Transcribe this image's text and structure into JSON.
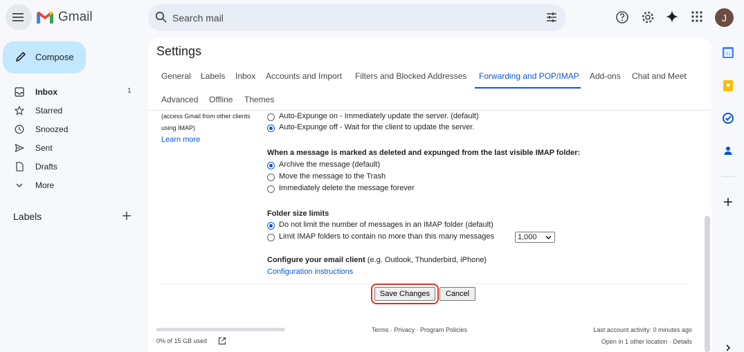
{
  "app": {
    "name": "Gmail",
    "search_placeholder": "Search mail",
    "avatar_initial": "J"
  },
  "sidebar": {
    "compose_label": "Compose",
    "items": [
      {
        "label": "Inbox",
        "count": "1",
        "icon": "inbox-icon"
      },
      {
        "label": "Starred",
        "count": "",
        "icon": "star-icon"
      },
      {
        "label": "Snoozed",
        "count": "",
        "icon": "clock-icon"
      },
      {
        "label": "Sent",
        "count": "",
        "icon": "send-icon"
      },
      {
        "label": "Drafts",
        "count": "",
        "icon": "draft-icon"
      },
      {
        "label": "More",
        "count": "",
        "icon": "chevron-down-icon"
      }
    ],
    "labels_header": "Labels"
  },
  "settings": {
    "title": "Settings",
    "tabs": [
      "General",
      "Labels",
      "Inbox",
      "Accounts and Import",
      "Filters and Blocked Addresses",
      "Forwarding and POP/IMAP",
      "Add-ons",
      "Chat and Meet",
      "Advanced",
      "Offline",
      "Themes"
    ],
    "active_tab": "Forwarding and POP/IMAP",
    "left_note": {
      "line1": "(access Gmail from other clients",
      "line2": "using IMAP)",
      "learn_more": "Learn more"
    },
    "expunge": {
      "on_label": "Auto-Expunge on",
      "on_desc": " - Immediately update the server. (default)",
      "off_label": "Auto-Expunge off",
      "off_desc": " - Wait for the client to update the server.",
      "selected": "off"
    },
    "deleted": {
      "title": "When a message is marked as deleted and expunged from the last visible IMAP folder:",
      "options": [
        "Archive the message (default)",
        "Move the message to the Trash",
        "Immediately delete the message forever"
      ],
      "selected_index": 0
    },
    "folder_size": {
      "title": "Folder size limits",
      "options": [
        "Do not limit the number of messages in an IMAP folder (default)",
        "Limit IMAP folders to contain no more than this many messages"
      ],
      "selected_index": 0,
      "limit_value": "1,000"
    },
    "configure": {
      "title": "Configure your email client",
      "subtitle": " (e.g. Outlook, Thunderbird, iPhone)",
      "link": "Configuration instructions"
    },
    "buttons": {
      "save": "Save Changes",
      "cancel": "Cancel"
    }
  },
  "footer": {
    "storage": "0% of 15 GB used",
    "storage_fraction": 0,
    "links": "Terms · Privacy · Program Policies",
    "activity": "Last account activity: 0 minutes ago",
    "location": "Open in 1 other location · Details"
  },
  "colors": {
    "accent": "#0b57d0",
    "compose_bg": "#c2e7ff",
    "highlight_ring": "#d93025"
  }
}
